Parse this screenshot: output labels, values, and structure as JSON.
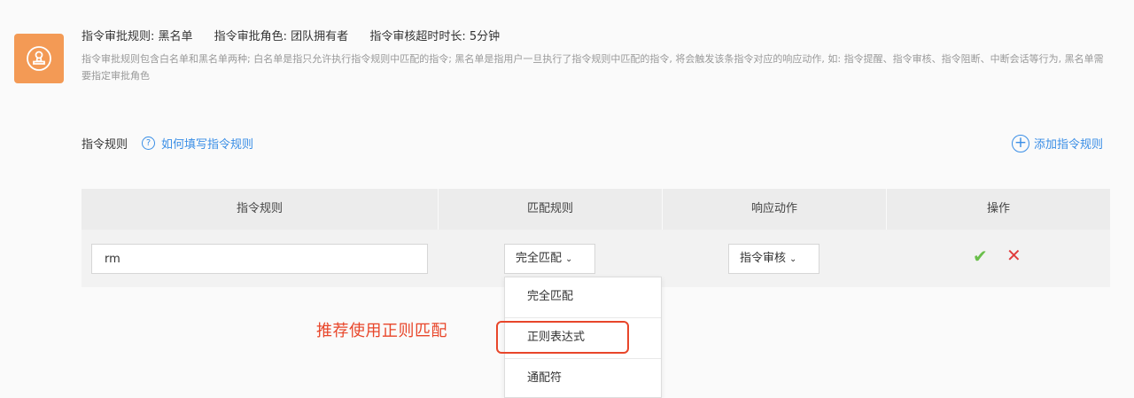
{
  "info": {
    "rule_type": "指令审批规则: 黑名单",
    "role": "指令审批角色: 团队拥有者",
    "timeout": "指令审核超时时长: 5分钟",
    "description": "指令审批规则包含白名单和黑名单两种; 白名单是指只允许执行指令规则中匹配的指令; 黑名单是指用户一旦执行了指令规则中匹配的指令, 将会触发该条指令对应的响应动作, 如: 指令提醒、指令审核、指令阻断、中断会话等行为, 黑名单需要指定审批角色"
  },
  "rules_section": {
    "title": "指令规则",
    "help_link": "如何填写指令规则",
    "add_link": "添加指令规则"
  },
  "table": {
    "headers": [
      "指令规则",
      "匹配规则",
      "响应动作",
      "操作"
    ],
    "row": {
      "rule_value": "rm",
      "match_value": "完全匹配",
      "action_value": "指令审核"
    }
  },
  "dropdown": {
    "options": [
      "完全匹配",
      "正则表达式",
      "通配符"
    ],
    "highlighted_index": 1
  },
  "annotation": "推荐使用正则匹配",
  "colors": {
    "accent": "#3a8ee6",
    "icon_bg": "#f39a55",
    "highlight": "#e8462a",
    "confirm": "#6abf4b",
    "cancel": "#e03c3c"
  },
  "icons": {
    "info": "stamp-icon",
    "help": "question-circle-icon",
    "add": "plus-circle-icon",
    "confirm": "check-icon",
    "cancel": "close-icon",
    "chevron": "chevron-down-icon"
  }
}
